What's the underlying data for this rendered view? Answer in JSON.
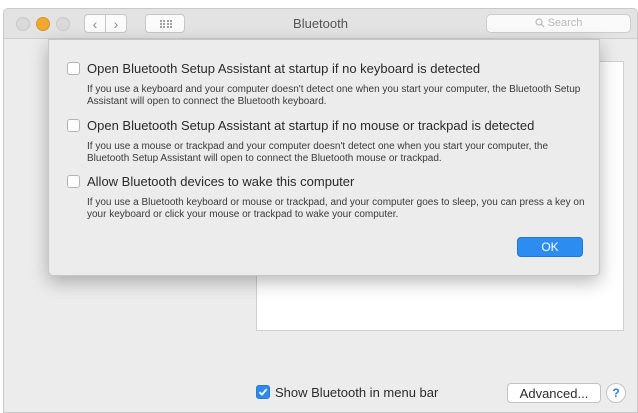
{
  "window": {
    "title": "Bluetooth",
    "search_placeholder": "Search"
  },
  "nav": {
    "back_glyph": "‹",
    "forward_glyph": "›"
  },
  "sheet": {
    "options": [
      {
        "label": "Open Bluetooth Setup Assistant at startup if no keyboard is detected",
        "description": "If you use a keyboard and your computer doesn't detect one when you start your computer, the Bluetooth Setup Assistant will open to connect the Bluetooth keyboard.",
        "checked": false
      },
      {
        "label": "Open Bluetooth Setup Assistant at startup if no mouse or trackpad is detected",
        "description": "If you use a mouse or trackpad and your computer doesn't detect one when you start your computer, the Bluetooth Setup Assistant will open to connect the Bluetooth mouse or trackpad.",
        "checked": false
      },
      {
        "label": "Allow Bluetooth devices to wake this computer",
        "description": "If you use a Bluetooth keyboard or mouse or trackpad, and your computer goes to sleep, you can press a key on your keyboard or click your mouse or trackpad to wake your computer.",
        "checked": false
      }
    ],
    "ok_label": "OK"
  },
  "footer": {
    "show_in_menu_bar_label": "Show Bluetooth in menu bar",
    "show_in_menu_bar_checked": true,
    "advanced_label": "Advanced...",
    "help_label": "?"
  },
  "colors": {
    "accent": "#2d8cf0",
    "minimize_light": "#f0a92f"
  }
}
